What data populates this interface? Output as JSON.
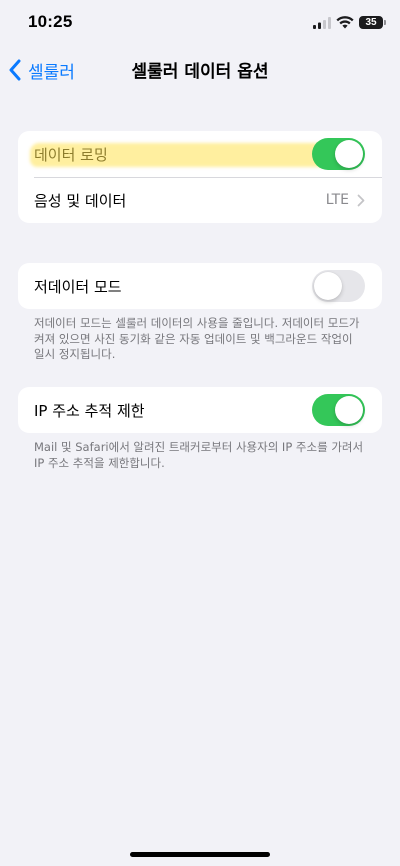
{
  "status_bar": {
    "time": "10:25",
    "battery": "35"
  },
  "nav": {
    "back_label": "셀룰러",
    "title": "셀룰러 데이터 옵션"
  },
  "group1": {
    "data_roaming": {
      "label": "데이터 로밍",
      "enabled": true
    },
    "voice_data": {
      "label": "음성 및 데이터",
      "value": "LTE"
    }
  },
  "group2": {
    "low_data_mode": {
      "label": "저데이터 모드",
      "enabled": false
    },
    "footnote": "저데이터 모드는 셀룰러 데이터의 사용을 줄입니다. 저데이터 모드가 켜져 있으면 사진 동기화 같은 자동 업데이트 및 백그라운드 작업이 일시 정지됩니다."
  },
  "group3": {
    "limit_ip_tracking": {
      "label": "IP 주소 추적 제한",
      "enabled": true
    },
    "footnote": "Mail 및 Safari에서 알려진 트래커로부터 사용자의 IP 주소를 가려서 IP 주소 추적을 제한합니다."
  },
  "colors": {
    "accent": "#0a7aff",
    "toggle_on": "#34c759",
    "toggle_off": "#e6e6ea",
    "highlight": "#ffe250"
  }
}
